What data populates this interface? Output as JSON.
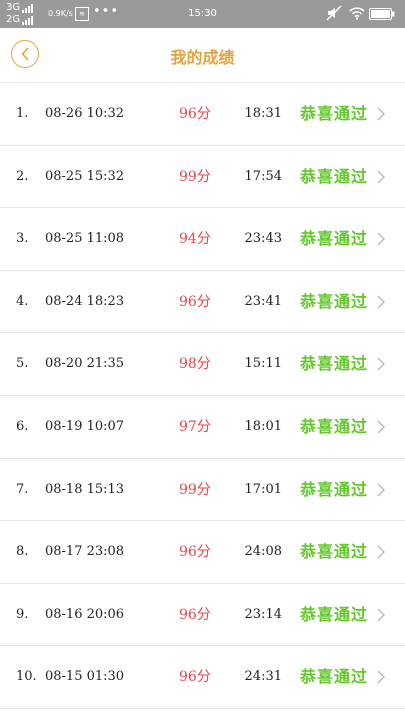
{
  "statusbar": {
    "net1": "3G",
    "net2": "2G",
    "speed": "0.9K/s",
    "time": "15:30"
  },
  "header": {
    "title": "我的成绩"
  },
  "records": [
    {
      "index": "1.",
      "datetime": "08-26  10:32",
      "score": "96分",
      "duration": "18:31",
      "status": "恭喜通过"
    },
    {
      "index": "2.",
      "datetime": "08-25  15:32",
      "score": "99分",
      "duration": "17:54",
      "status": "恭喜通过"
    },
    {
      "index": "3.",
      "datetime": "08-25  11:08",
      "score": "94分",
      "duration": "23:43",
      "status": "恭喜通过"
    },
    {
      "index": "4.",
      "datetime": "08-24  18:23",
      "score": "96分",
      "duration": "23:41",
      "status": "恭喜通过"
    },
    {
      "index": "5.",
      "datetime": "08-20  21:35",
      "score": "98分",
      "duration": "15:11",
      "status": "恭喜通过"
    },
    {
      "index": "6.",
      "datetime": "08-19  10:07",
      "score": "97分",
      "duration": "18:01",
      "status": "恭喜通过"
    },
    {
      "index": "7.",
      "datetime": "08-18  15:13",
      "score": "99分",
      "duration": "17:01",
      "status": "恭喜通过"
    },
    {
      "index": "8.",
      "datetime": "08-17  23:08",
      "score": "96分",
      "duration": "24:08",
      "status": "恭喜通过"
    },
    {
      "index": "9.",
      "datetime": "08-16  20:06",
      "score": "96分",
      "duration": "23:14",
      "status": "恭喜通过"
    },
    {
      "index": "10.",
      "datetime": "08-15  01:30",
      "score": "96分",
      "duration": "24:31",
      "status": "恭喜通过"
    }
  ],
  "colors": {
    "accent": "#e9a23b",
    "score": "#e8474b",
    "pass": "#62c82a"
  }
}
